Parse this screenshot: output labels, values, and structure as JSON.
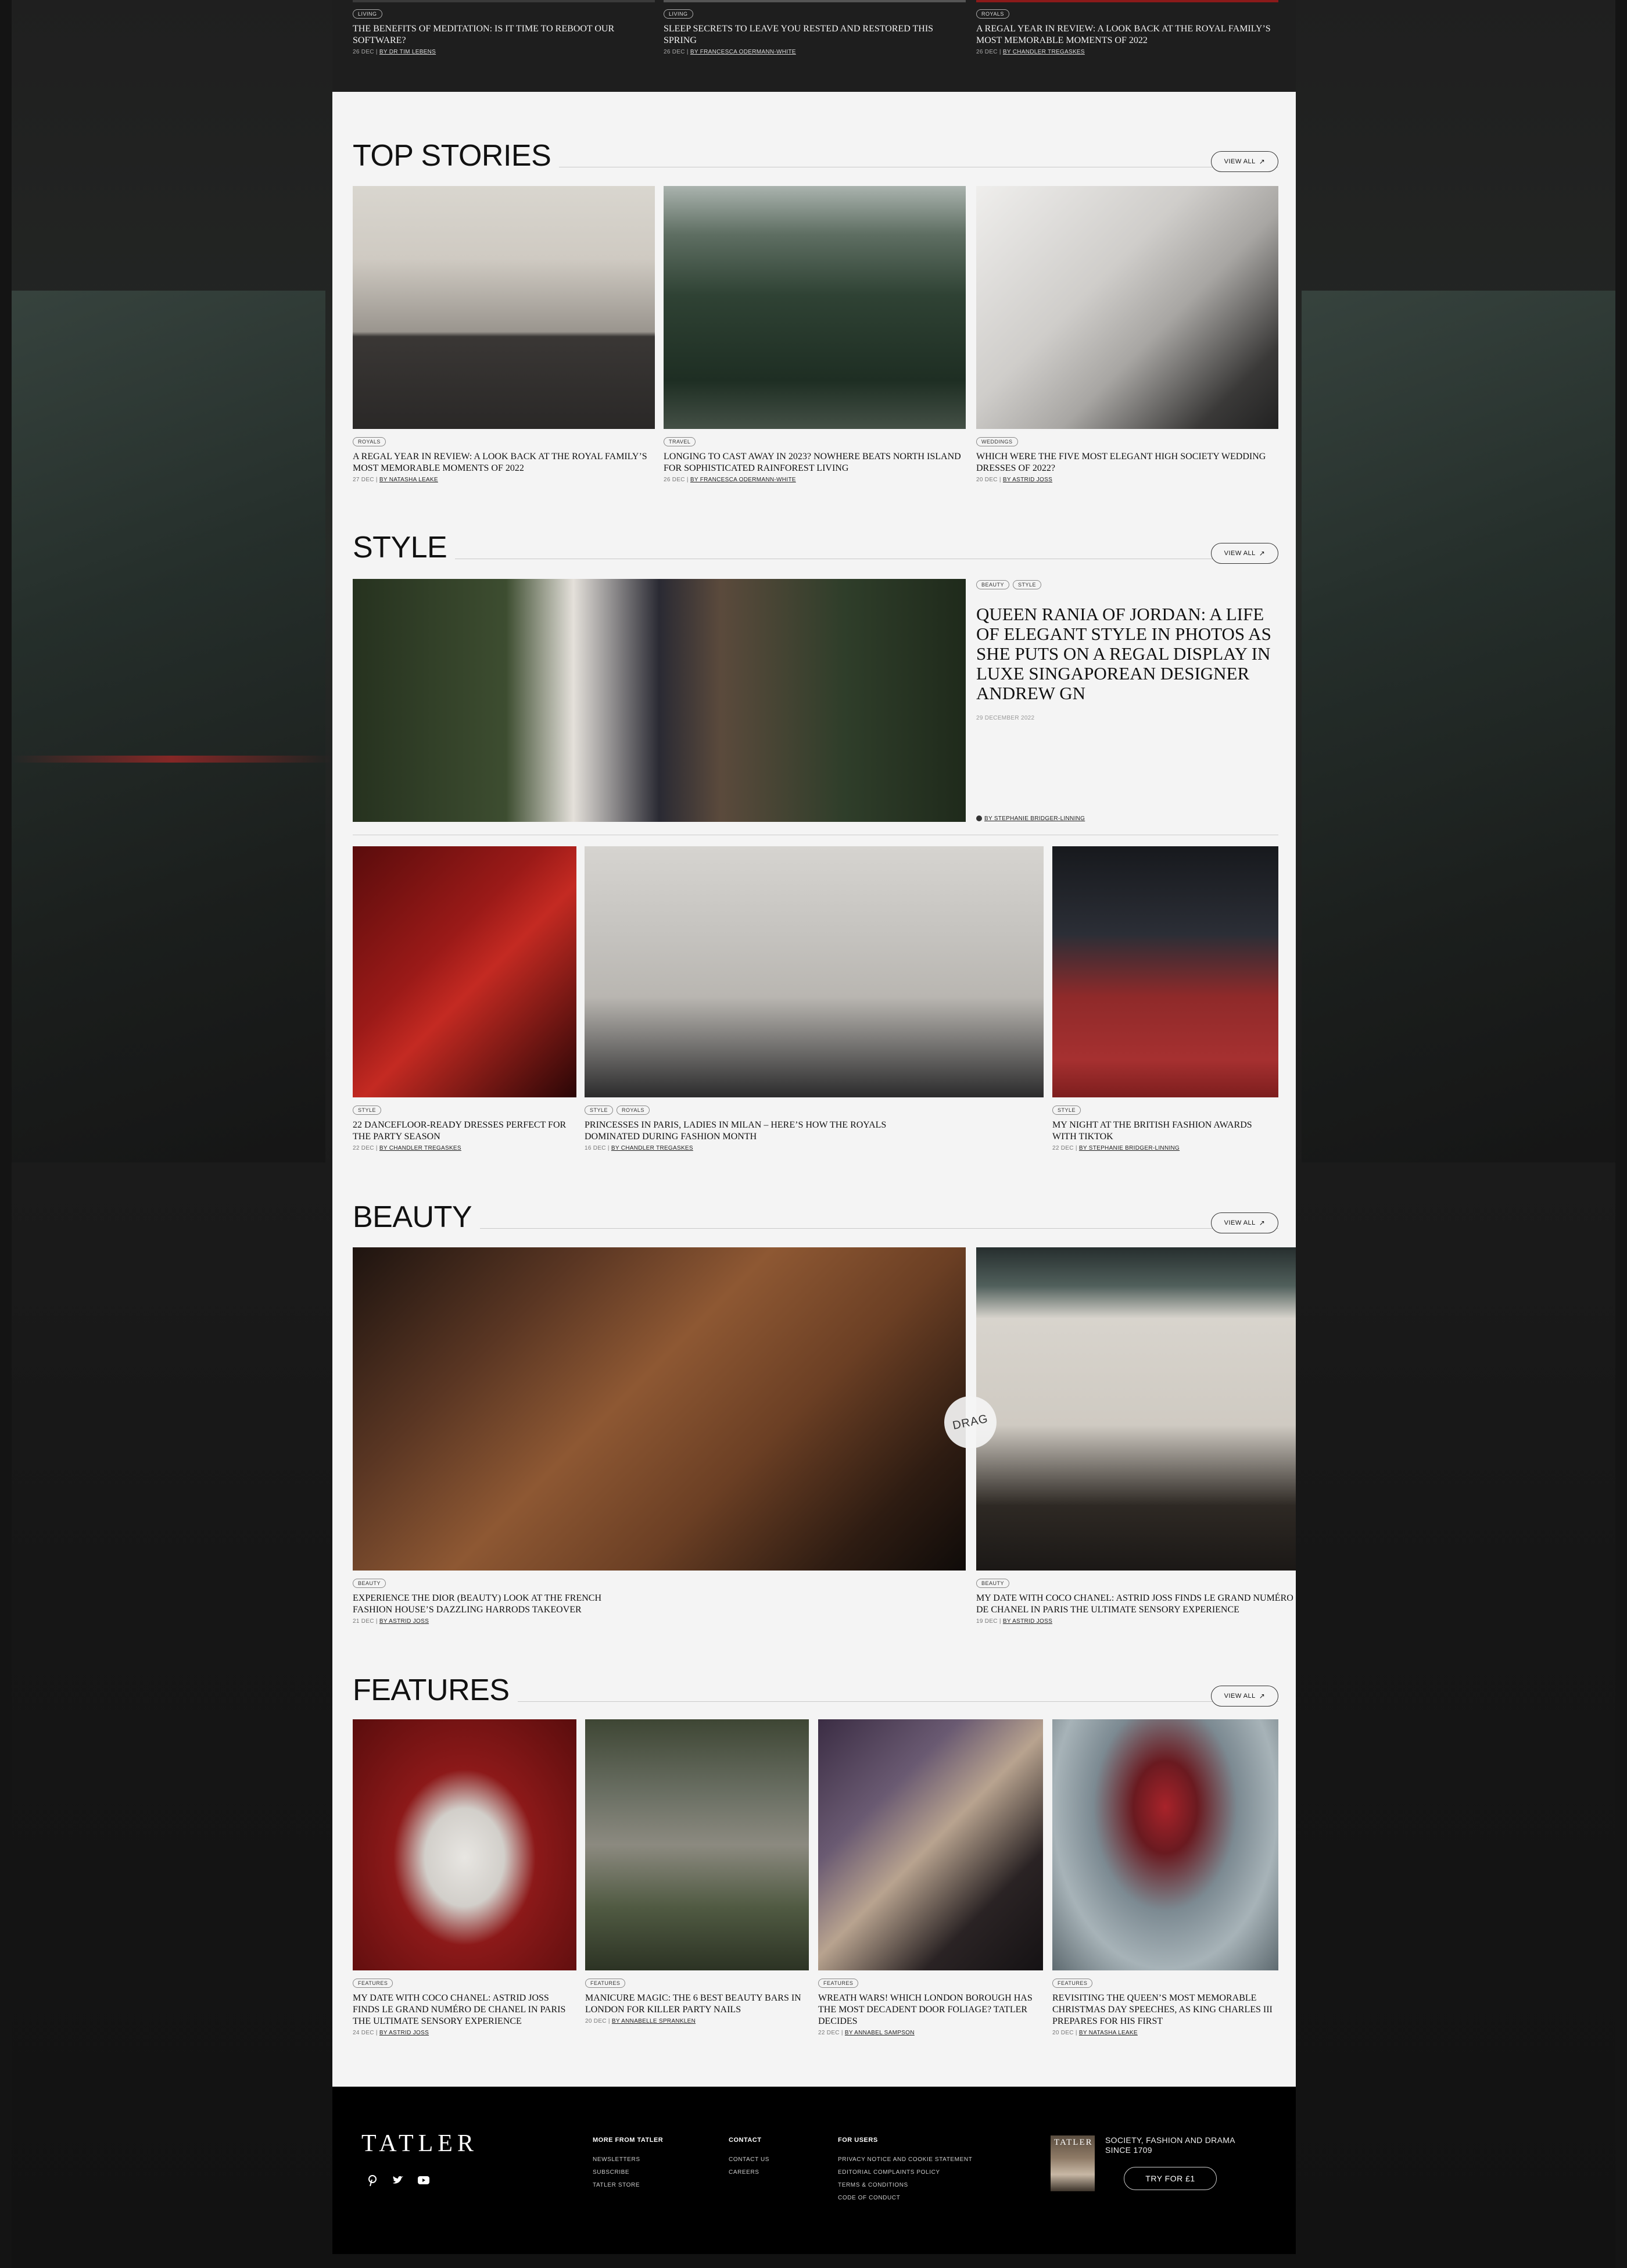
{
  "top_strip": [
    {
      "tag": "Living",
      "title": "The benefits of meditation: is it time to reboot our software?",
      "date": "26 DEC",
      "author": "By Dr Tim Lebens"
    },
    {
      "tag": "Living",
      "title": "Sleep secrets to leave you rested and restored this spring",
      "date": "26 DEC",
      "author": "By Francesca Odermann-White"
    },
    {
      "tag": "Royals",
      "title": "A regal year in review: a look back at the royal family’s most memorable moments of 2022",
      "date": "26 DEC",
      "author": "By Chandler Tregaskes"
    }
  ],
  "view_all_label": "View all",
  "view_all_icon": "arrow-up-right-icon",
  "top_stories": {
    "heading": "TOP STORIES",
    "cards": [
      {
        "tag": "Royals",
        "title": "A regal year in review: a look back at the royal family’s most memorable moments of 2022",
        "date": "27 DEC",
        "author": "By Natasha Leake"
      },
      {
        "tag": "Travel",
        "title": "Longing to cast away in 2023? Nowhere beats north island for sophisticated rainforest living",
        "date": "26 DEC",
        "author": "By Francesca Odermann-White"
      },
      {
        "tag": "Weddings",
        "title": "Which were the five most elegant high society wedding dresses of 2022?",
        "date": "20 DEC",
        "author": "By Astrid Joss"
      }
    ]
  },
  "style": {
    "heading": "STYLE",
    "feature": {
      "tags": [
        "Beauty",
        "Style"
      ],
      "title": "Queen Rania of Jordan: a life of elegant style in photos as she puts on a regal display in luxe Singaporean designer Andrew Gn",
      "date": "29 DECEMBER 2022",
      "author": "By Stephanie Bridger-Linning"
    },
    "cards": [
      {
        "tags": [
          "Style"
        ],
        "title": "22 dancefloor-ready dresses perfect for the party season",
        "date": "22 DEC",
        "author": "By Chandler Tregaskes"
      },
      {
        "tags": [
          "Style",
          "Royals"
        ],
        "title": "Princesses in Paris, ladies in Milan – here’s how the royals dominated during fashion month",
        "date": "16 DEC",
        "author": "By Chandler Tregaskes"
      },
      {
        "tags": [
          "Style"
        ],
        "title": "My night at the British Fashion Awards with TikTok",
        "date": "22 DEC",
        "author": "By Stephanie Bridger-Linning"
      }
    ]
  },
  "beauty": {
    "heading": "BEAUTY",
    "drag_label": "DRAG",
    "cards": [
      {
        "tag": "Beauty",
        "title": "Experience the Dior (Beauty) look at the French fashion house’s dazzling Harrods takeover",
        "date": "21 DEC",
        "author": "By Astrid Joss"
      },
      {
        "tag": "Beauty",
        "title": "My date with Coco Chanel: Astrid Joss finds Le Grand Numéro de Chanel in Paris the ultimate sensory experience",
        "date": "19 DEC",
        "author": "By Astrid Joss"
      }
    ]
  },
  "features": {
    "heading": "FEATURES",
    "cards": [
      {
        "tag": "Features",
        "title": "My date with Coco Chanel: Astrid Joss finds Le Grand Numéro de Chanel in Paris the ultimate sensory experience",
        "date": "24 DEC",
        "author": "By Astrid Joss"
      },
      {
        "tag": "Features",
        "title": "Manicure magic: the 6 best beauty bars in London for killer party nails",
        "date": "20 DEC",
        "author": "By Annabelle Spranklen"
      },
      {
        "tag": "Features",
        "title": "Wreath wars! Which London borough has the most decadent door foliage? Tatler decides",
        "date": "22 DEC",
        "author": "By Annabel Sampson"
      },
      {
        "tag": "Features",
        "title": "Revisiting the Queen’s most memorable Christmas Day speeches, as King Charles III prepares for his first",
        "date": "20 DEC",
        "author": "By Natasha Leake"
      }
    ]
  },
  "footer": {
    "logo": "TATLER",
    "social": [
      "pinterest-icon",
      "twitter-icon",
      "youtube-icon"
    ],
    "columns": [
      {
        "heading": "More from Tatler",
        "links": [
          "Newsletters",
          "Subscribe",
          "Tatler Store"
        ]
      },
      {
        "heading": "Contact",
        "links": [
          "Contact us",
          "Careers"
        ]
      },
      {
        "heading": "For users",
        "links": [
          "Privacy notice and cookie statement",
          "Editorial complaints policy",
          "Terms & conditions",
          "Code of conduct"
        ]
      }
    ],
    "promo": {
      "cover_text": "TATLER",
      "text": "Society, fashion and drama since 1709",
      "button": "Try for £1"
    }
  }
}
